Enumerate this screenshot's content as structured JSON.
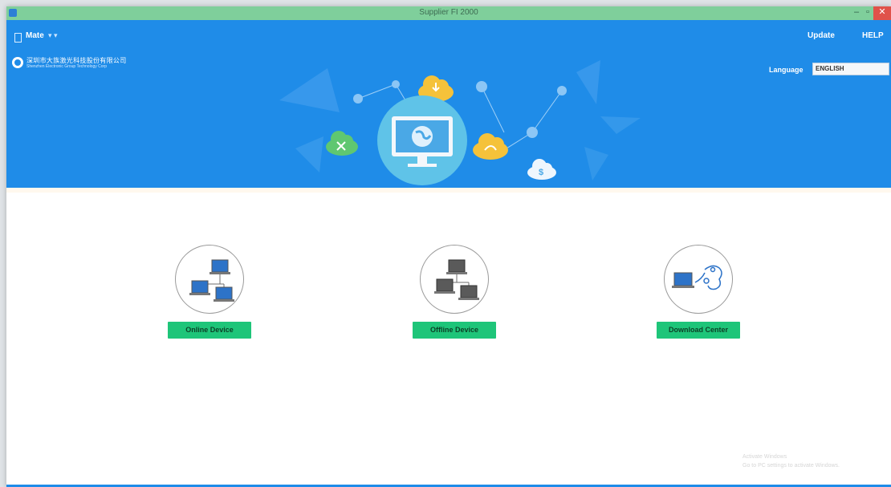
{
  "window": {
    "title": "Supplier FI 2000",
    "controls": [
      "–",
      "▫",
      "✕"
    ]
  },
  "header": {
    "user": "Mate",
    "user_arrow": "▾ ▾",
    "update": "Update",
    "help": "HELP",
    "company_name": "深圳市大族激光科技股份有限公司",
    "company_subtitle": "Shenzhen Electronic Group Technology Corp",
    "language_label": "Language",
    "language_value": "ENGLISH"
  },
  "options": [
    {
      "label": "Online Device",
      "icon": "online-network-icon"
    },
    {
      "label": "Offline Device",
      "icon": "offline-network-icon"
    },
    {
      "label": "Download Center",
      "icon": "download-center-icon"
    }
  ],
  "watermark": {
    "line1": "Activate Windows",
    "line2": "Go to PC settings to activate Windows."
  },
  "colors": {
    "banner": "#1f8ce8",
    "titlebar": "#7fcf9b",
    "button": "#1ec579",
    "close": "#e0524a"
  }
}
